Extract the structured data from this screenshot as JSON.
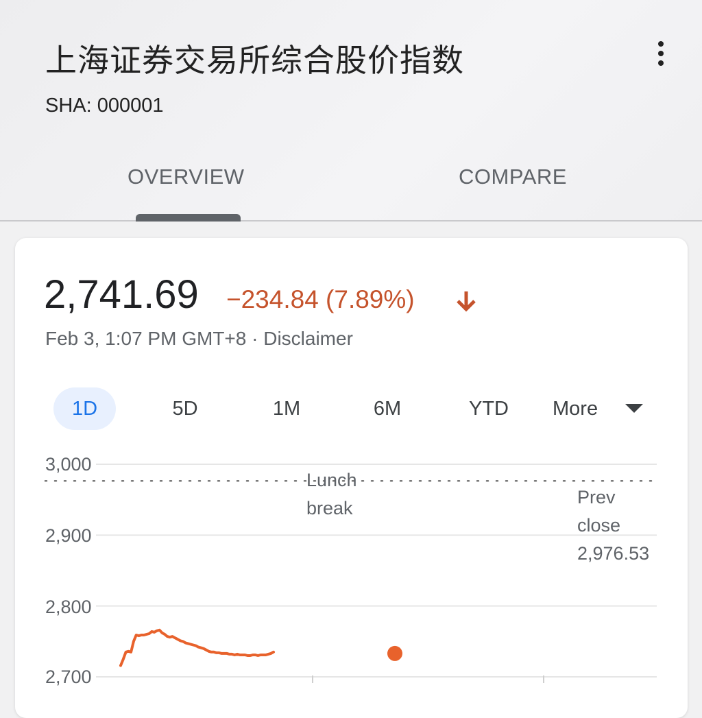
{
  "header": {
    "title": "上海证券交易所综合股价指数",
    "ticker": "SHA: 000001",
    "tabs": [
      {
        "label": "OVERVIEW",
        "selected": true
      },
      {
        "label": "COMPARE",
        "selected": false
      }
    ],
    "menu_icon": "more-vert-icon"
  },
  "quote": {
    "price": "2,741.69",
    "change": "−234.84 (7.89%)",
    "direction_icon": "arrow-down-icon",
    "timestamp": "Feb 3, 1:07 PM GMT+8 · Disclaimer"
  },
  "ranges": {
    "items": [
      "1D",
      "5D",
      "1M",
      "6M",
      "YTD",
      "More"
    ],
    "selected": "1D"
  },
  "colors": {
    "accent": "#1a73e8",
    "negative": "#c5532c",
    "line": "#e8622c",
    "text": "#202124",
    "muted": "#5f6368"
  },
  "chart_data": {
    "type": "line",
    "y_tick_labels": [
      "3,000",
      "2,900",
      "2,800",
      "2,700"
    ],
    "ylim": [
      2700,
      3000
    ],
    "reference_line": {
      "label_line1": "Prev",
      "label_line2": "close",
      "value_label": "2,976.53",
      "value": 2976.53
    },
    "annotation": {
      "line1": "Lunch",
      "line2": "break"
    },
    "series": [
      {
        "x": [
          0,
          2,
          4,
          6,
          8,
          10,
          12,
          14,
          16,
          18,
          20,
          22,
          24,
          26,
          28,
          30,
          32,
          34,
          36,
          38,
          40,
          42,
          44,
          46,
          48,
          50,
          52,
          54,
          56,
          58,
          60,
          62,
          64,
          66,
          68,
          70,
          72,
          74,
          76,
          78,
          80,
          82,
          84,
          86,
          88,
          90,
          92,
          94,
          96,
          98,
          100,
          102,
          104,
          106,
          108,
          110,
          112,
          114,
          116,
          118
        ],
        "values": [
          2716,
          2725,
          2735,
          2736,
          2735,
          2750,
          2759,
          2758,
          2759,
          2759,
          2760,
          2761,
          2764,
          2763,
          2765,
          2766,
          2762,
          2760,
          2757,
          2756,
          2757,
          2755,
          2753,
          2751,
          2750,
          2748,
          2747,
          2746,
          2745,
          2744,
          2742,
          2741,
          2740,
          2738,
          2736,
          2735,
          2735,
          2734,
          2734,
          2733,
          2733,
          2733,
          2732,
          2732,
          2731,
          2732,
          2731,
          2731,
          2731,
          2730,
          2730,
          2731,
          2731,
          2730,
          2731,
          2731,
          2731,
          2732,
          2733,
          2735
        ]
      }
    ],
    "current_marker": {
      "value": 2733
    }
  }
}
